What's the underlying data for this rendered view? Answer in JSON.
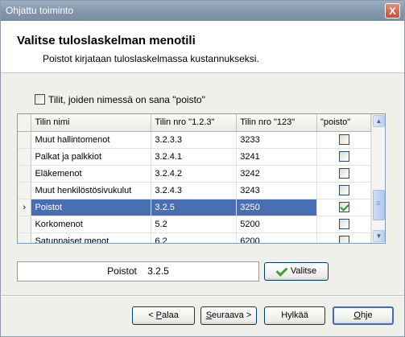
{
  "window": {
    "title": "Ohjattu toiminto",
    "close_glyph": "X"
  },
  "header": {
    "title": "Valitse tuloslaskelman menotili",
    "subtitle": "Poistot kirjataan tuloslaskelmassa kustannukseksi."
  },
  "filter": {
    "label": "Tilit, joiden nimessä on sana \"poisto\"",
    "checked": false
  },
  "grid": {
    "columns": [
      "Tilin nimi",
      "Tilin nro \"1.2.3\"",
      "Tilin nro \"123\"",
      "\"poisto\""
    ],
    "rows": [
      {
        "name": "Muut hallintomenot",
        "nro_dot": "3.2.3.3",
        "nro": "3233",
        "poisto": false
      },
      {
        "name": "Palkat ja palkkiot",
        "nro_dot": "3.2.4.1",
        "nro": "3241",
        "poisto": false
      },
      {
        "name": "Eläkemenot",
        "nro_dot": "3.2.4.2",
        "nro": "3242",
        "poisto": false
      },
      {
        "name": "Muut henkilöstösivukulut",
        "nro_dot": "3.2.4.3",
        "nro": "3243",
        "poisto": false
      },
      {
        "name": "Poistot",
        "nro_dot": "3.2.5",
        "nro": "3250",
        "poisto": true
      },
      {
        "name": "Korkomenot",
        "nro_dot": "5.2",
        "nro": "5200",
        "poisto": false
      },
      {
        "name": "Satunnaiset menot",
        "nro_dot": "6.2",
        "nro": "6200",
        "poisto": false
      }
    ],
    "selected_row_marker": "›",
    "scroll_up_glyph": "▲",
    "scroll_down_glyph": "▼"
  },
  "selection": {
    "text": "Poistot    3.2.5"
  },
  "buttons": {
    "valitse": "Valitse",
    "palaa_prefix": "< ",
    "palaa_u": "P",
    "palaa_rest": "alaa",
    "seuraava_u": "S",
    "seuraava_rest": "euraava >",
    "hylkaa": "Hylkää",
    "ohje_u": "O",
    "ohje_rest": "hje"
  }
}
